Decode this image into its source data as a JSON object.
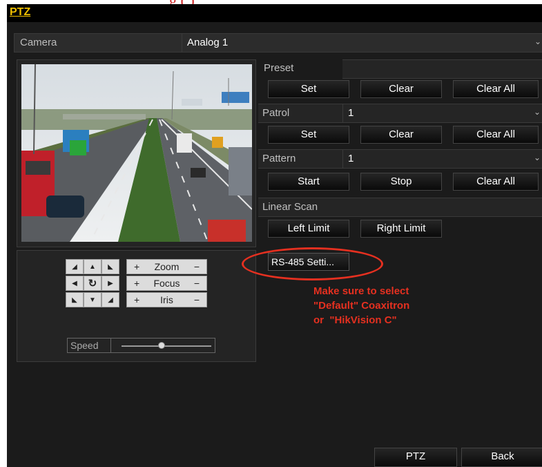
{
  "window": {
    "title": "PTZ"
  },
  "camera": {
    "label": "Camera",
    "value": "Analog 1"
  },
  "preset": {
    "label": "Preset",
    "value": "",
    "buttons": [
      "Set",
      "Clear",
      "Clear All"
    ]
  },
  "patrol": {
    "label": "Patrol",
    "value": "1",
    "buttons": [
      "Set",
      "Clear",
      "Clear All"
    ]
  },
  "pattern": {
    "label": "Pattern",
    "value": "1",
    "buttons": [
      "Start",
      "Stop",
      "Clear All"
    ]
  },
  "linear_scan": {
    "label": "Linear Scan",
    "buttons": [
      "Left Limit",
      "Right Limit"
    ]
  },
  "rs485_button": "RS-485 Setti...",
  "annotation": {
    "lines": [
      "Make sure to select",
      "\"Default\" Coaxitron",
      "or  \"HikVision C\""
    ],
    "color": "#e53020"
  },
  "controls": {
    "zoom": {
      "label": "Zoom",
      "plus": "+",
      "minus": "−"
    },
    "focus": {
      "label": "Focus",
      "plus": "+",
      "minus": "−"
    },
    "iris": {
      "label": "Iris",
      "plus": "+",
      "minus": "−"
    },
    "speed_label": "Speed"
  },
  "footer": {
    "ptz": "PTZ",
    "back": "Back"
  },
  "accent_color": "#f0c000"
}
